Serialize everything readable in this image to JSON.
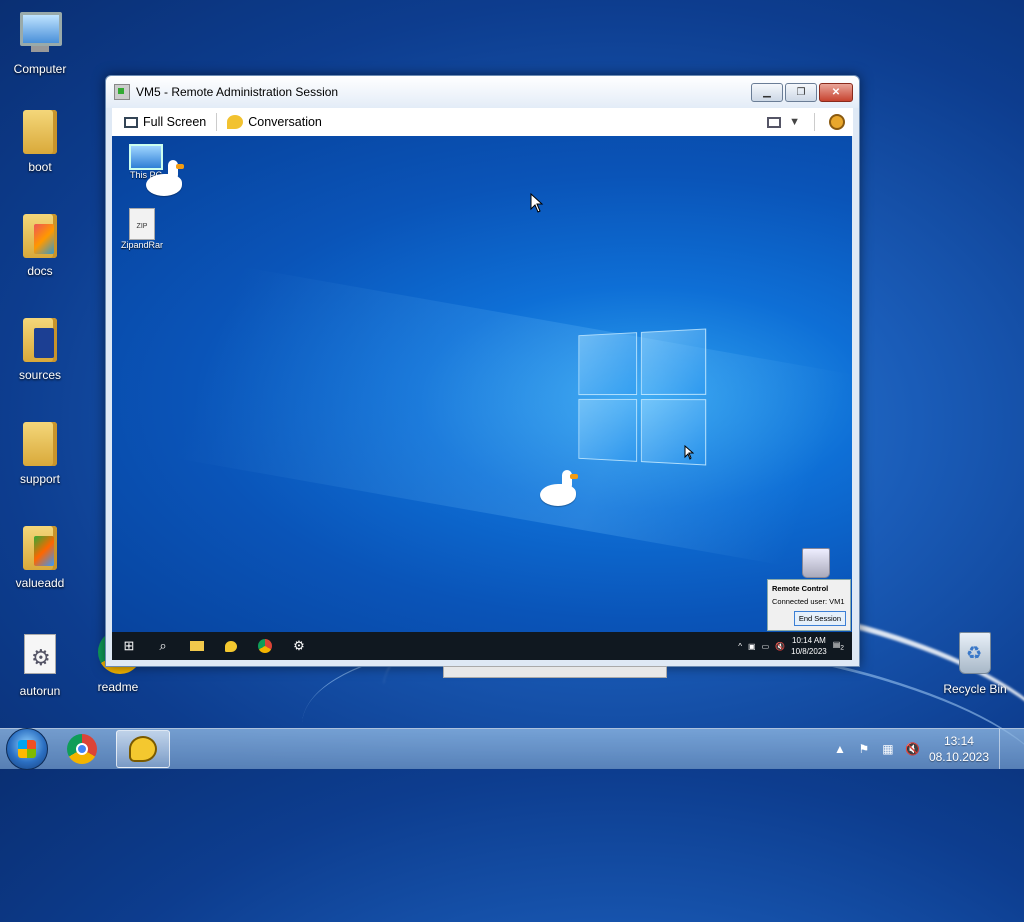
{
  "desktop": {
    "icons": [
      {
        "label": "Computer"
      },
      {
        "label": "boot"
      },
      {
        "label": "docs"
      },
      {
        "label": "sources"
      },
      {
        "label": "support"
      },
      {
        "label": "valueadd"
      },
      {
        "label": "autorun"
      },
      {
        "label": "readme"
      },
      {
        "label": "Recycle Bin"
      }
    ]
  },
  "remote_window": {
    "title": "VM5 - Remote Administration Session",
    "toolbar": {
      "full_screen": "Full Screen",
      "conversation": "Conversation"
    },
    "remote_desktop": {
      "icons": [
        {
          "label": "This PC"
        },
        {
          "label": "ZipandRar"
        }
      ],
      "zip_badge": "ZIP",
      "remote_control": {
        "title": "Remote Control",
        "connected_user": "Connected user:  VM1",
        "end_session": "End Session"
      },
      "taskbar": {
        "time": "10:14 AM",
        "date": "10/8/2023",
        "notifications": "2"
      }
    }
  },
  "taskbar": {
    "time": "13:14",
    "date": "08.10.2023"
  }
}
